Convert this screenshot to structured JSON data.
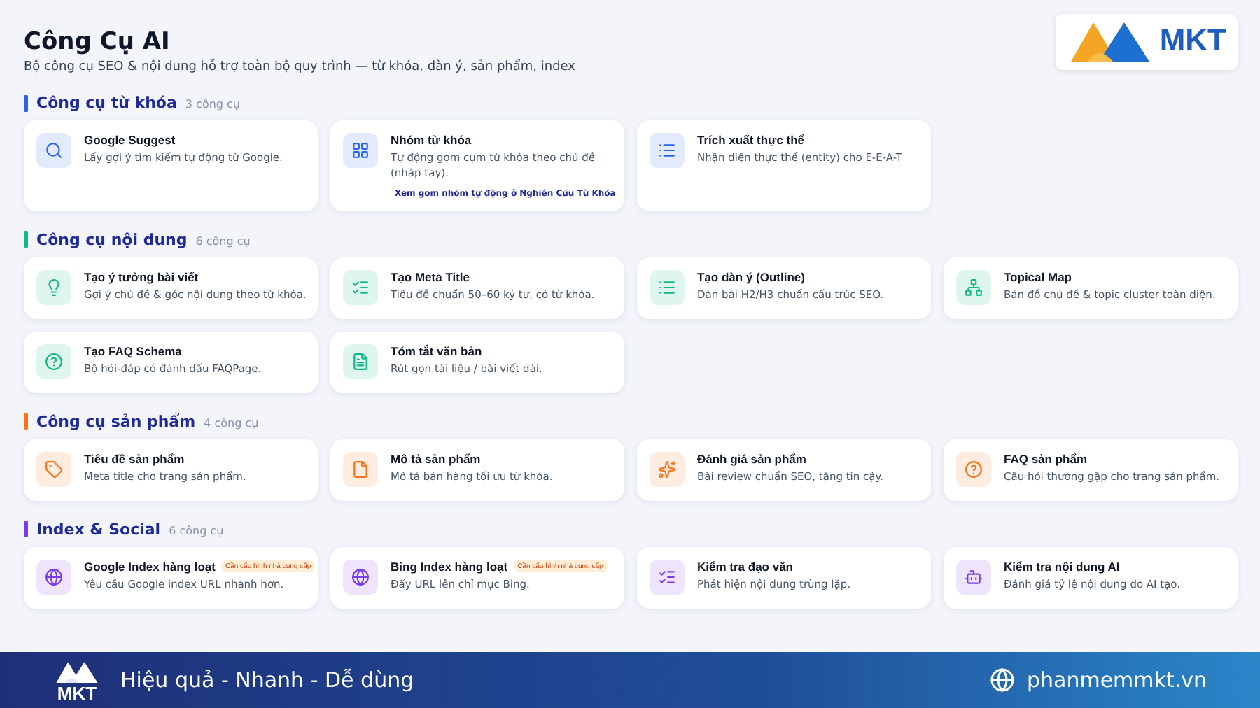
{
  "header": {
    "title": "Công Cụ AI",
    "subtitle": "Bộ công cụ SEO & nội dung hỗ trợ toàn bộ quy trình — từ khóa, dàn ý, sản phẩm, index",
    "logo_text": "MKT"
  },
  "sections": [
    {
      "title": "Công cụ từ khóa",
      "count": "3 công cụ",
      "color": "#2563eb",
      "tools": [
        {
          "kind": "search",
          "title": "Google Suggest",
          "description": "Lấy gợi ý tìm kiếm tự động từ Google."
        },
        {
          "kind": "grid",
          "title": "Nhóm từ khóa",
          "description": "Tự động gom cụm từ khóa theo chủ đề (nháp tay).",
          "link": "Xem gom nhóm tự động ở Nghiên Cứu Từ Khóa"
        },
        {
          "kind": "list",
          "title": "Trích xuất thực thể",
          "description": "Nhận diện thực thể (entity) cho E-E-A-T"
        }
      ]
    },
    {
      "title": "Công cụ nội dung",
      "count": "6 công cụ",
      "color": "#10b981",
      "tools": [
        {
          "kind": "bulb",
          "title": "Tạo ý tưởng bài viết",
          "description": "Gợi ý chủ đề & góc nội dung theo từ khóa."
        },
        {
          "kind": "checklist",
          "title": "Tạo Meta Title",
          "description": "Tiêu đề chuẩn 50–60 ký tự, có từ khóa."
        },
        {
          "kind": "list",
          "title": "Tạo dàn ý (Outline)",
          "description": "Dàn bài H2/H3 chuẩn cấu trúc SEO."
        },
        {
          "kind": "network",
          "title": "Topical Map",
          "description": "Bản đồ chủ đề & topic cluster toàn diện."
        },
        {
          "kind": "help",
          "title": "Tạo FAQ Schema",
          "description": "Bộ hỏi-đáp có đánh dấu FAQPage."
        },
        {
          "kind": "doc",
          "title": "Tóm tắt văn bản",
          "description": "Rút gọn tài liệu / bài viết dài."
        }
      ]
    },
    {
      "title": "Công cụ sản phẩm",
      "count": "4 công cụ",
      "color": "#f97316",
      "tools": [
        {
          "kind": "tag",
          "title": "Tiêu đề sản phẩm",
          "description": "Meta title cho trang sản phẩm."
        },
        {
          "kind": "file",
          "title": "Mô tả sản phẩm",
          "description": "Mô tả bán hàng tối ưu từ khóa."
        },
        {
          "kind": "sparkles",
          "title": "Đánh giá sản phẩm",
          "description": "Bài review chuẩn SEO, tăng tin cậy."
        },
        {
          "kind": "help",
          "title": "FAQ sản phẩm",
          "description": "Câu hỏi thường gặp cho trang sản phẩm."
        }
      ]
    },
    {
      "title": "Index & Social",
      "count": "6 công cụ",
      "color": "#7c3aed",
      "tools": [
        {
          "kind": "globe",
          "title": "Google Index hàng loạt",
          "badge": "Cần cấu hình nhà cung cấp",
          "description": "Yêu cầu Google index URL nhanh hơn."
        },
        {
          "kind": "globe",
          "title": "Bing Index hàng loạt",
          "badge": "Cần cấu hình nhà cung cấp",
          "description": "Đẩy URL lên chỉ mục Bing."
        },
        {
          "kind": "checklist",
          "title": "Kiểm tra đạo văn",
          "description": "Phát hiện nội dung trùng lặp."
        },
        {
          "kind": "bot",
          "title": "Kiểm tra nội dung AI",
          "description": "Đánh giá tỷ lệ nội dung do AI tạo."
        }
      ]
    }
  ],
  "footer": {
    "logo_text": "MKT",
    "tagline": "Hiệu quả - Nhanh - Dễ dùng",
    "website": "phanmemmkt.vn"
  }
}
